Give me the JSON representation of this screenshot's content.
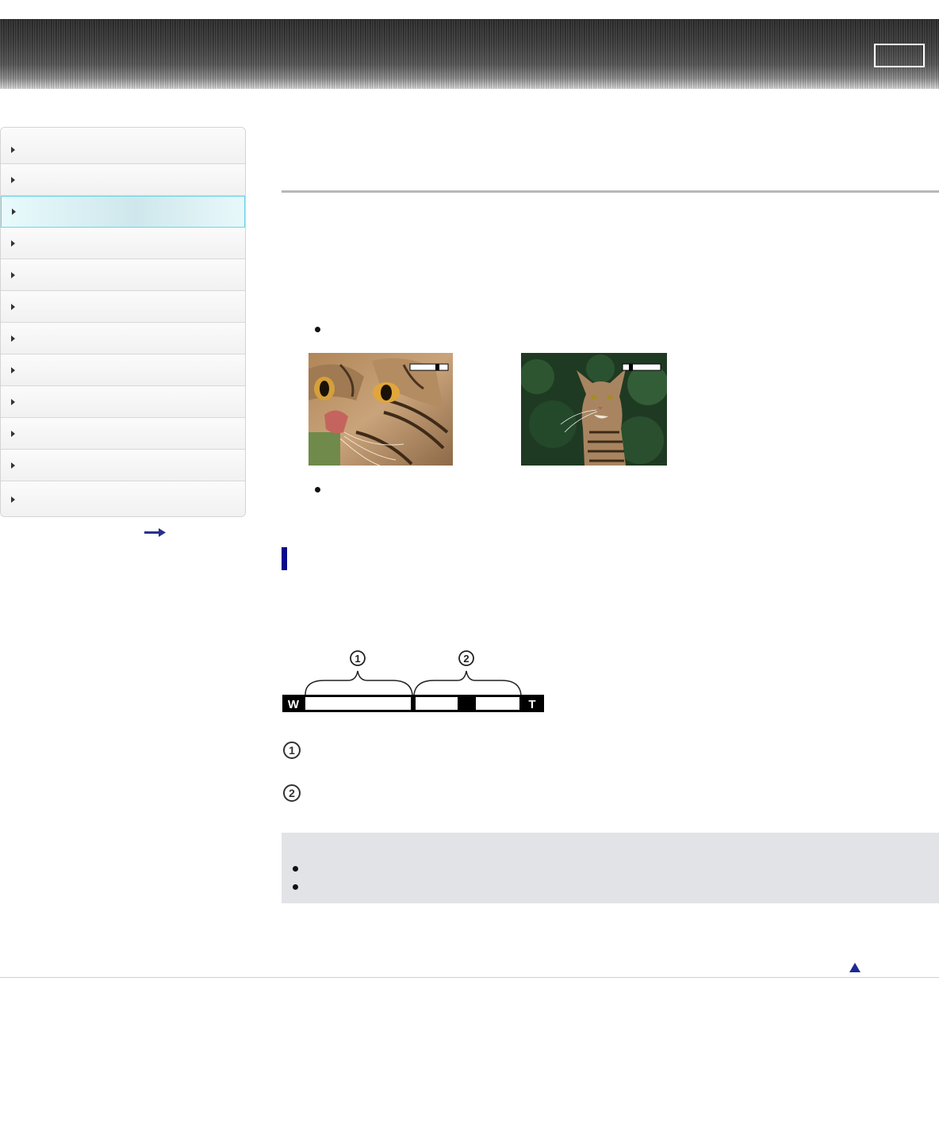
{
  "header": {
    "background_color": "#3a3a3a",
    "button_label": ""
  },
  "sidebar": {
    "items": [
      {
        "label": "",
        "active": false
      },
      {
        "label": "",
        "active": false
      },
      {
        "label": "",
        "active": true
      },
      {
        "label": "",
        "active": false
      },
      {
        "label": "",
        "active": false
      },
      {
        "label": "",
        "active": false
      },
      {
        "label": "",
        "active": false
      },
      {
        "label": "",
        "active": false
      },
      {
        "label": "",
        "active": false
      },
      {
        "label": "",
        "active": false
      },
      {
        "label": "",
        "active": false
      },
      {
        "label": "",
        "active": false
      }
    ],
    "active_color": "#6ed4e6",
    "link_icon": "right-arrow-icon"
  },
  "main": {
    "title": "",
    "bullets": [
      "",
      ""
    ],
    "photos": [
      {
        "name": "cat-closeup-photo",
        "zoom_indicator": "zoom-bar-tele"
      },
      {
        "name": "cat-wide-photo",
        "zoom_indicator": "zoom-bar-wide"
      }
    ],
    "section_marker_color": "#0a0a8c",
    "zoom_bar": {
      "left_label": "W",
      "right_label": "T",
      "range_1_label": "①",
      "range_2_label": "②"
    },
    "legend": [
      {
        "number": "①",
        "text": ""
      },
      {
        "number": "②",
        "text": ""
      }
    ],
    "notes": {
      "background_color": "#e1e3e6",
      "items": [
        "",
        ""
      ]
    }
  },
  "footer": {
    "back_to_top_icon": "up-triangle-icon"
  }
}
